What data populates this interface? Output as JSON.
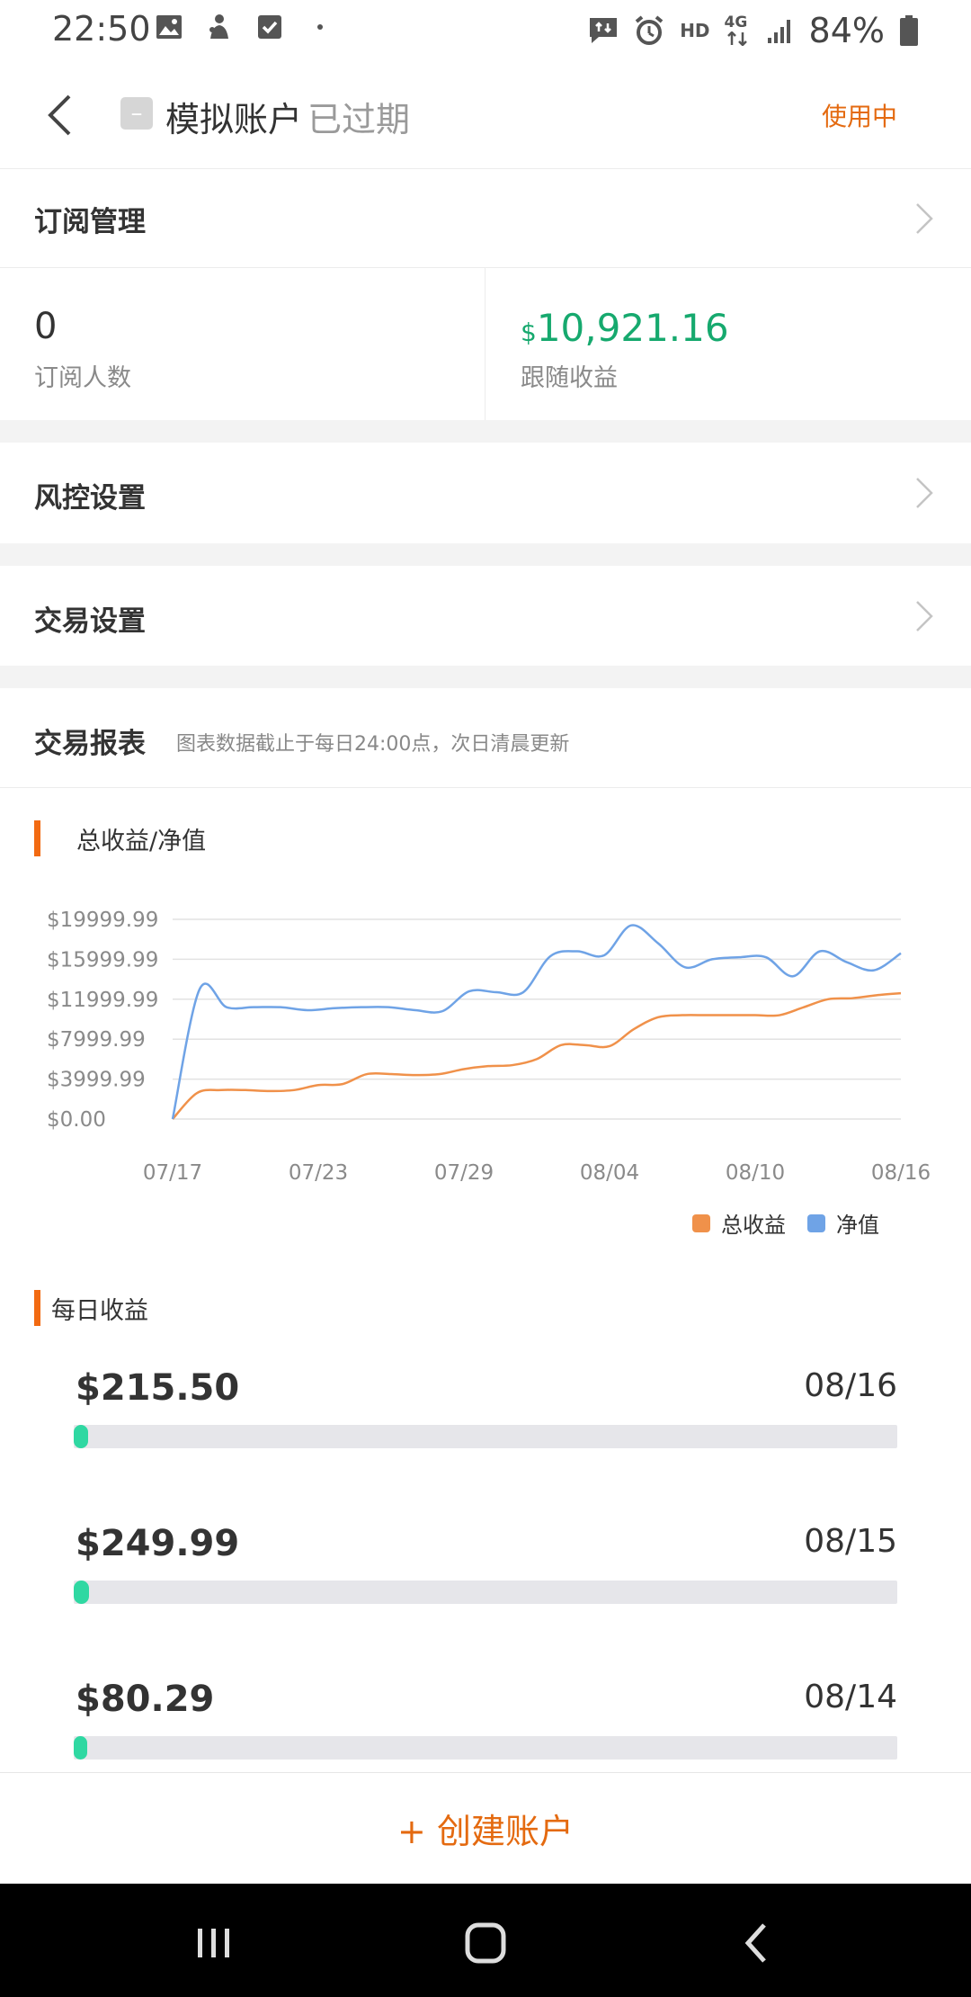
{
  "status_bar": {
    "time": "22:50",
    "network": "4G",
    "hd": "HD",
    "battery": "84%"
  },
  "header": {
    "account_name": "模拟账户",
    "account_status": "已过期",
    "state": "使用中"
  },
  "subscription": {
    "title": "订阅管理",
    "subscribers_value": "0",
    "subscribers_label": "订阅人数",
    "profit_currency": "$",
    "profit_value": "10,921.16",
    "profit_label": "跟随收益"
  },
  "risk": {
    "title": "风控设置"
  },
  "trade_settings": {
    "title": "交易设置"
  },
  "report": {
    "title": "交易报表",
    "note": "图表数据截止于每日24:00点，次日清晨更新"
  },
  "chart_data": {
    "type": "line",
    "title": "总收益/净值",
    "y_ticks": [
      "$0.00",
      "$3999.99",
      "$7999.99",
      "$11999.99",
      "$15999.99",
      "$19999.99"
    ],
    "ylim": [
      0,
      19999.99
    ],
    "x_ticks": [
      "07/17",
      "07/23",
      "07/29",
      "08/04",
      "08/10",
      "08/16"
    ],
    "grid": true,
    "legend_position": "bottom-right",
    "series": [
      {
        "name": "总收益",
        "color": "#f0914a",
        "values": [
          0,
          2600,
          2900,
          2900,
          2800,
          2900,
          3400,
          3500,
          4500,
          4500,
          4400,
          4500,
          5000,
          5300,
          5400,
          6000,
          7400,
          7400,
          7300,
          9000,
          10200,
          10400,
          10400,
          10400,
          10400,
          10400,
          11200,
          12000,
          12100,
          12400,
          12600
        ]
      },
      {
        "name": "净值",
        "color": "#6fa3e6",
        "values": [
          0,
          13000,
          11200,
          11200,
          11200,
          10900,
          11100,
          11200,
          11200,
          10900,
          10800,
          12800,
          12700,
          12700,
          16300,
          16800,
          16400,
          19400,
          17600,
          15200,
          16000,
          16200,
          16200,
          14300,
          16800,
          15700,
          14900,
          16600
        ]
      }
    ]
  },
  "daily": {
    "title": "每日收益",
    "items": [
      {
        "amount": "$215.50",
        "date": "08/16",
        "fill": 0.017
      },
      {
        "amount": "$249.99",
        "date": "08/15",
        "fill": 0.019
      },
      {
        "amount": "$80.29",
        "date": "08/14",
        "fill": 0.008
      }
    ]
  },
  "actions": {
    "create_account": "+ 创建账户"
  }
}
